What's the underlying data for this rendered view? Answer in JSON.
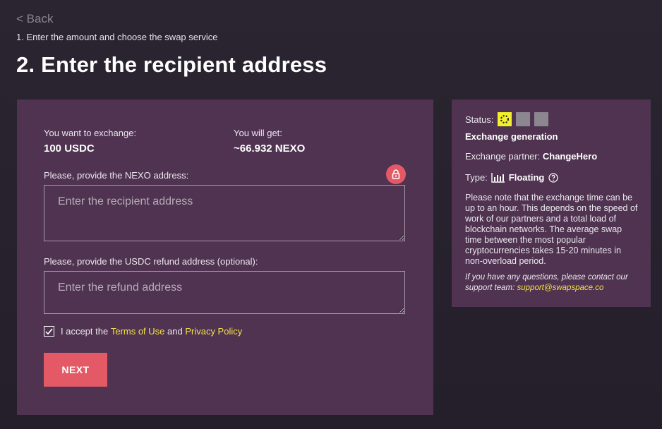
{
  "nav": {
    "back_label": "< Back",
    "step1_label": "1. Enter the amount and choose the swap service"
  },
  "page": {
    "title": "2. Enter the recipient address"
  },
  "exchange": {
    "want_label": "You want to exchange:",
    "want_value": "100 USDC",
    "get_label": "You will get:",
    "get_value": "~66.932 NEXO"
  },
  "form": {
    "recipient_label": "Please, provide the NEXO address:",
    "recipient_placeholder": "Enter the recipient address",
    "recipient_value": "",
    "refund_label": "Please, provide the USDC refund address (optional):",
    "refund_placeholder": "Enter the refund address",
    "refund_value": "",
    "accept_prefix": "I accept the ",
    "terms_label": "Terms of Use",
    "accept_and": " and ",
    "privacy_label": "Privacy Policy",
    "accept_checked": true,
    "next_label": "NEXT",
    "lock_icon": "lock-icon"
  },
  "status": {
    "status_label": "Status:",
    "stage_text": "Exchange generation",
    "partner_label": "Exchange partner:",
    "partner_value": "ChangeHero",
    "type_label": "Type:",
    "type_value": "Floating",
    "note": "Please note that the exchange time can be up to an hour. This depends on the speed of work of our partners and a total load of blockchain networks. The average swap time between the most popular cryptocurrencies takes 15-20 minutes in non-overload period.",
    "support_prefix": "If you have any questions, please contact our support team: ",
    "support_email": "support@swapspace.co"
  },
  "colors": {
    "page_bg": "#2a2530",
    "card_bg": "#4f3350",
    "accent_red": "#e35a66",
    "link_yellow": "#f3e04a",
    "status_active": "#f3f029",
    "status_idle": "#8b8690"
  }
}
